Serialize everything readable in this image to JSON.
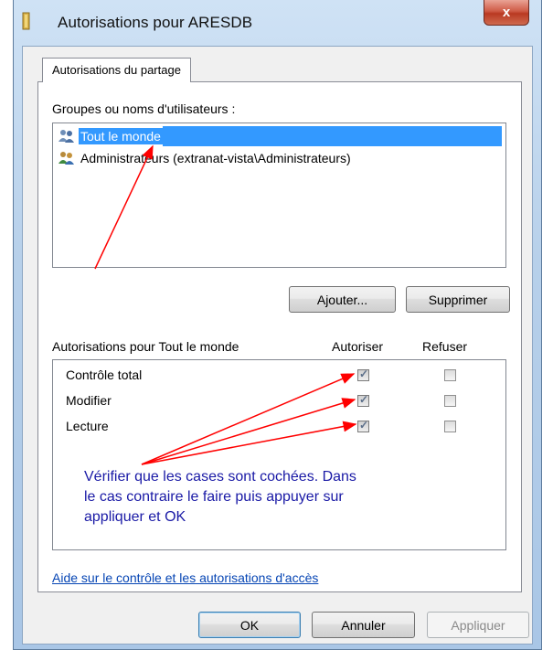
{
  "window": {
    "title": "Autorisations pour ARESDB",
    "close_label": "x"
  },
  "tab": {
    "label": "Autorisations du partage"
  },
  "groups": {
    "label": "Groupes ou noms d'utilisateurs :",
    "items": [
      {
        "name": "Tout le monde",
        "selected": true
      },
      {
        "name": "Administrateurs (extranat-vista\\Administrateurs)",
        "selected": false
      }
    ],
    "add_label": "Ajouter...",
    "remove_label": "Supprimer"
  },
  "permissions": {
    "header_label": "Autorisations pour Tout le monde",
    "allow_label": "Autoriser",
    "deny_label": "Refuser",
    "rows": [
      {
        "label": "Contrôle total",
        "allow": true,
        "deny": false
      },
      {
        "label": "Modifier",
        "allow": true,
        "deny": false
      },
      {
        "label": "Lecture",
        "allow": true,
        "deny": false
      }
    ]
  },
  "annotation": {
    "text": "Vérifier que les cases sont cochées. Dans le cas contraire le faire puis appuyer sur appliquer et OK",
    "color": "#1a1aa6",
    "arrow_color": "#ff0000"
  },
  "help_link": "Aide sur le contrôle et les autorisations d'accès",
  "footer": {
    "ok_label": "OK",
    "cancel_label": "Annuler",
    "apply_label": "Appliquer"
  }
}
